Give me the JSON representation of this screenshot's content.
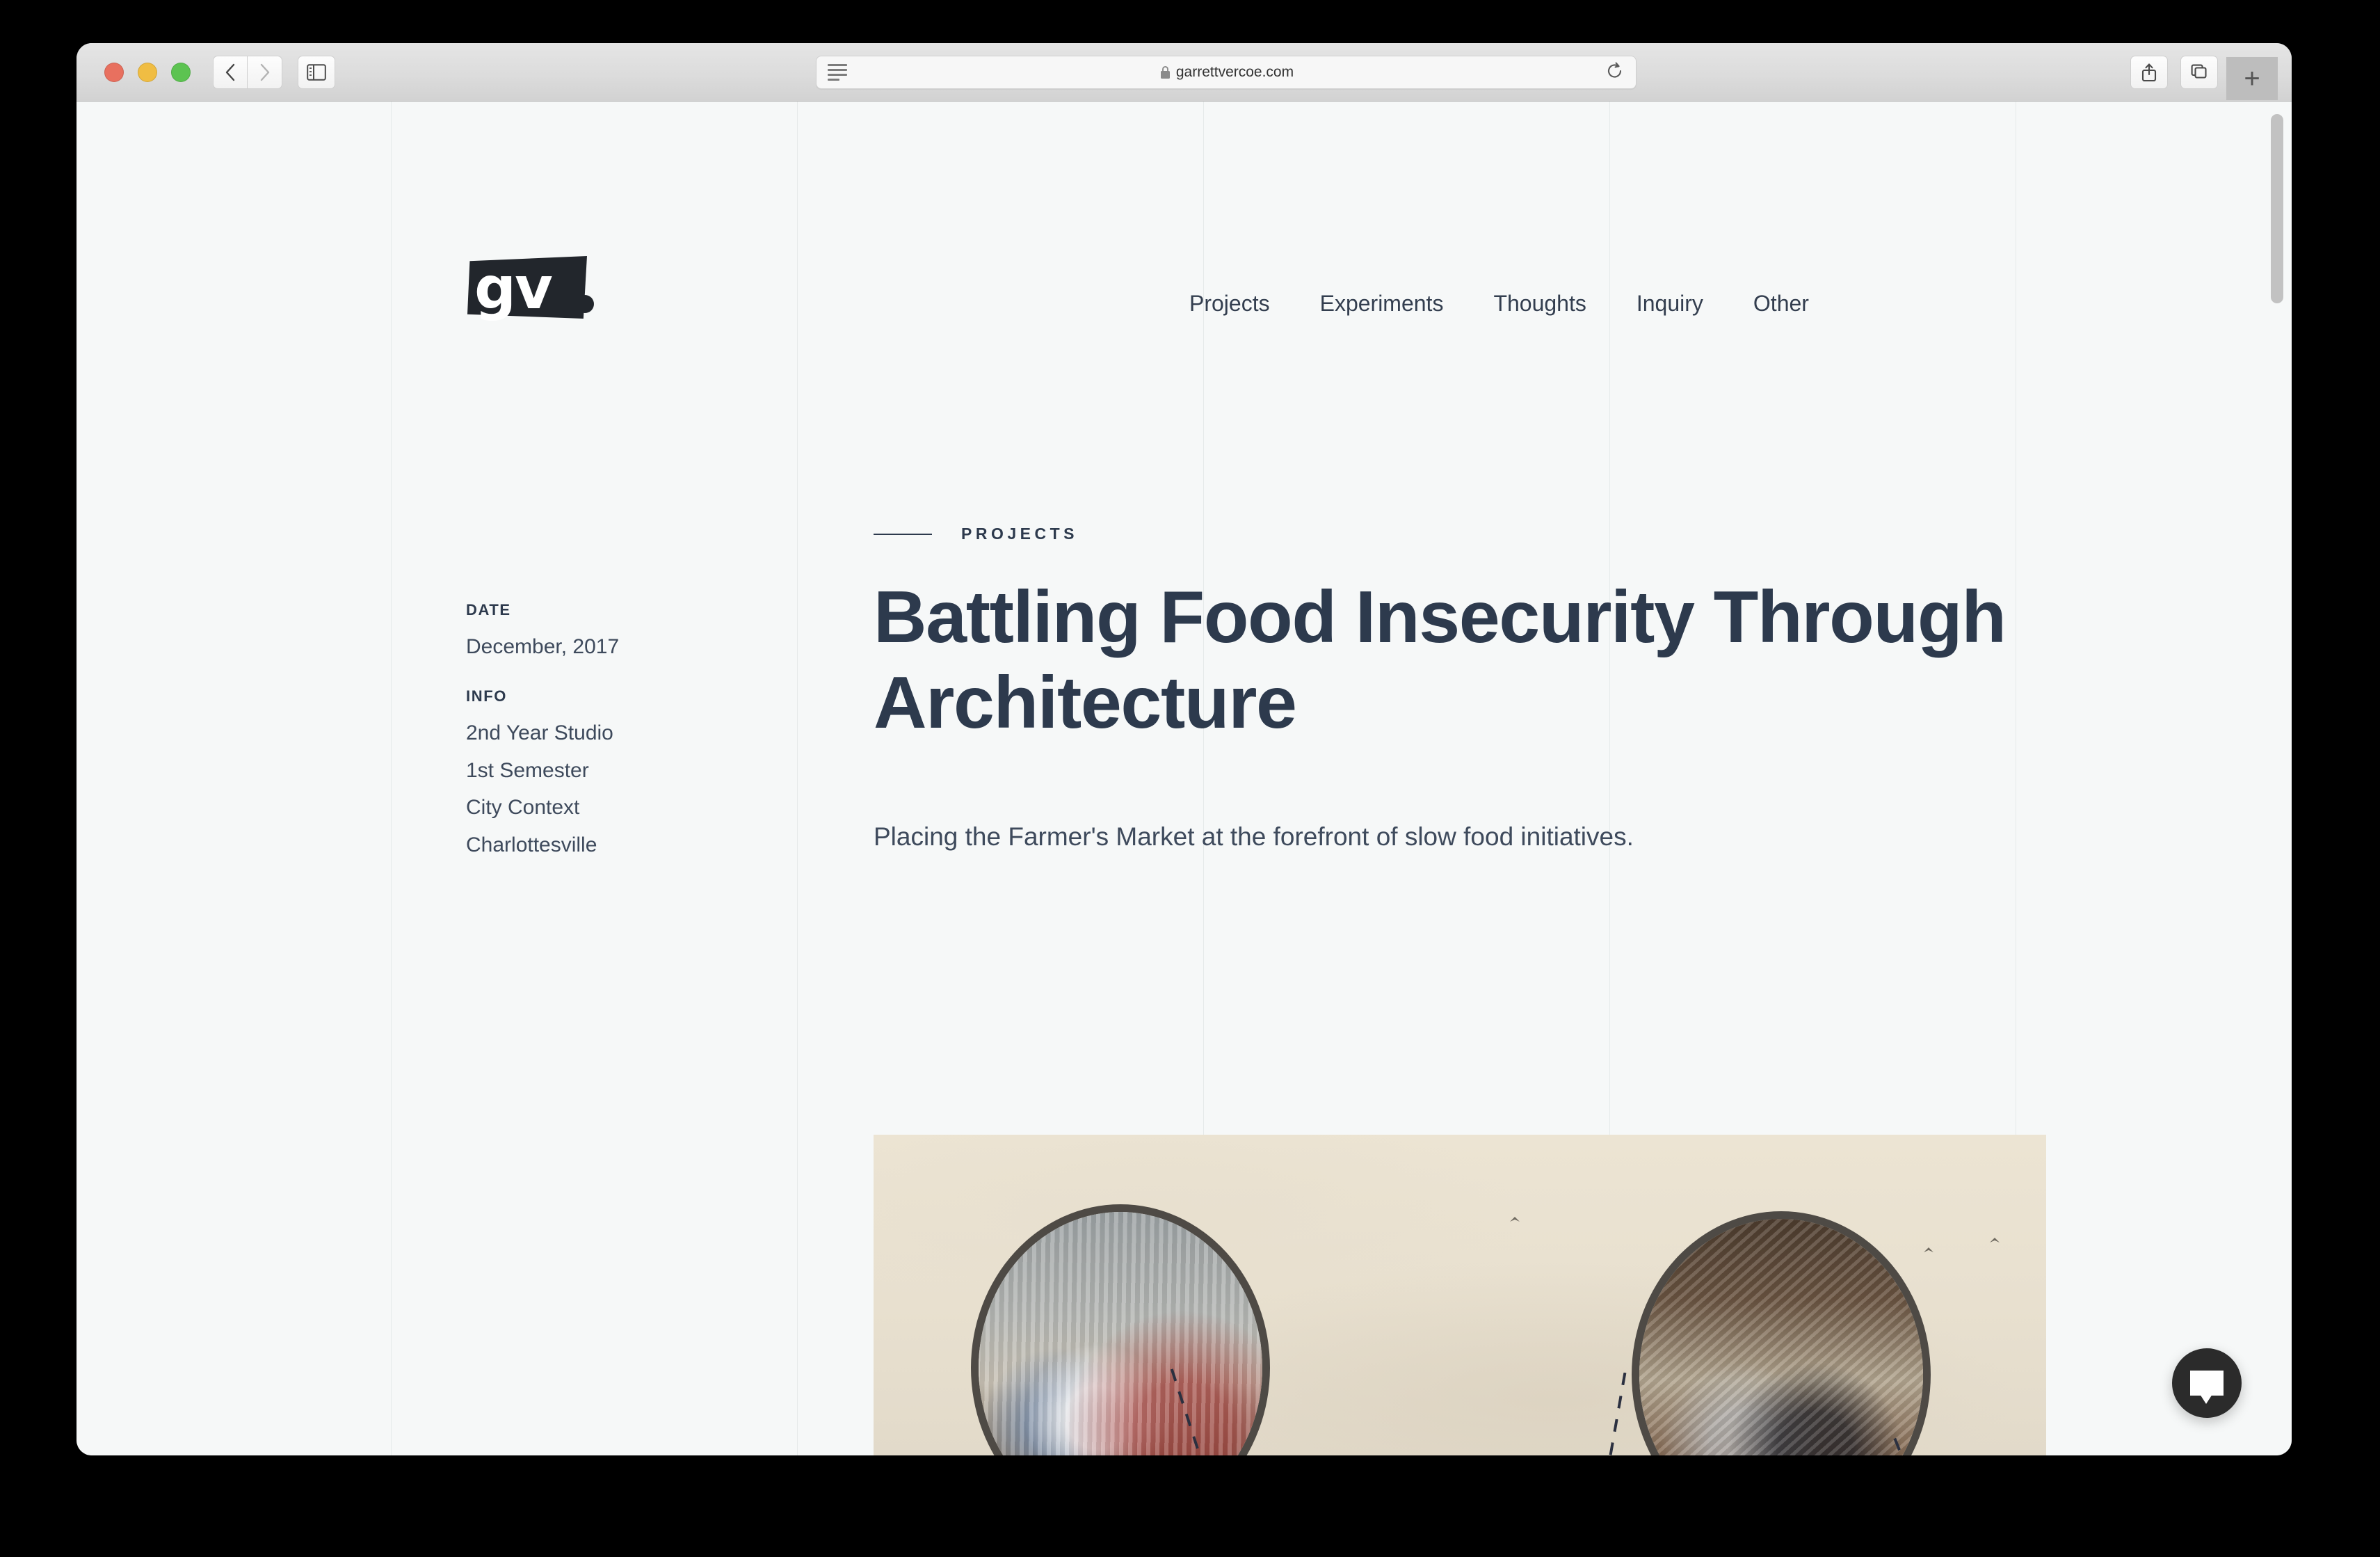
{
  "browser": {
    "app": "Safari",
    "url": "garrettvercoe.com",
    "secure_icon": "lock-icon",
    "reader_icon": "reader-view-icon",
    "reload_icon": "reload-icon",
    "back_icon": "chevron-left-icon",
    "forward_icon": "chevron-right-icon",
    "sidebar_icon": "sidebar-toggle-icon",
    "share_icon": "share-icon",
    "tabs_icon": "tab-overview-icon",
    "newtab_label": "+",
    "traffic_lights": {
      "close": "#e8705f",
      "minimize": "#f0bd43",
      "zoom": "#5cc351"
    }
  },
  "site": {
    "logo_text": "gv",
    "logo_dot": "•",
    "nav": [
      {
        "label": "Projects"
      },
      {
        "label": "Experiments"
      },
      {
        "label": "Thoughts"
      },
      {
        "label": "Inquiry"
      },
      {
        "label": "Other"
      }
    ]
  },
  "meta": {
    "date_label": "DATE",
    "date_value": "December, 2017",
    "info_label": "INFO",
    "info_values": [
      "2nd Year Studio",
      "1st Semester",
      "City Context",
      "Charlottesville"
    ]
  },
  "article": {
    "eyebrow": "PROJECTS",
    "headline": "Battling Food Insecurity Through Architecture",
    "subhead": "Placing the Farmer's Market at the forefront of slow food initiatives.",
    "hero_alt": "Sepia architectural collage: two circular vignettes of a farmers market interior connected by dashed lines over a cloudy sky"
  },
  "widgets": {
    "chat_icon": "chat-bubble-icon"
  },
  "colors": {
    "page_background": "#f6f8f8",
    "text_dark": "#2d3a4d",
    "text_body": "#3e4a5c",
    "logo_background": "#22262c",
    "chat_background": "#2b2b2b",
    "hero_background": "#ece4d3"
  }
}
